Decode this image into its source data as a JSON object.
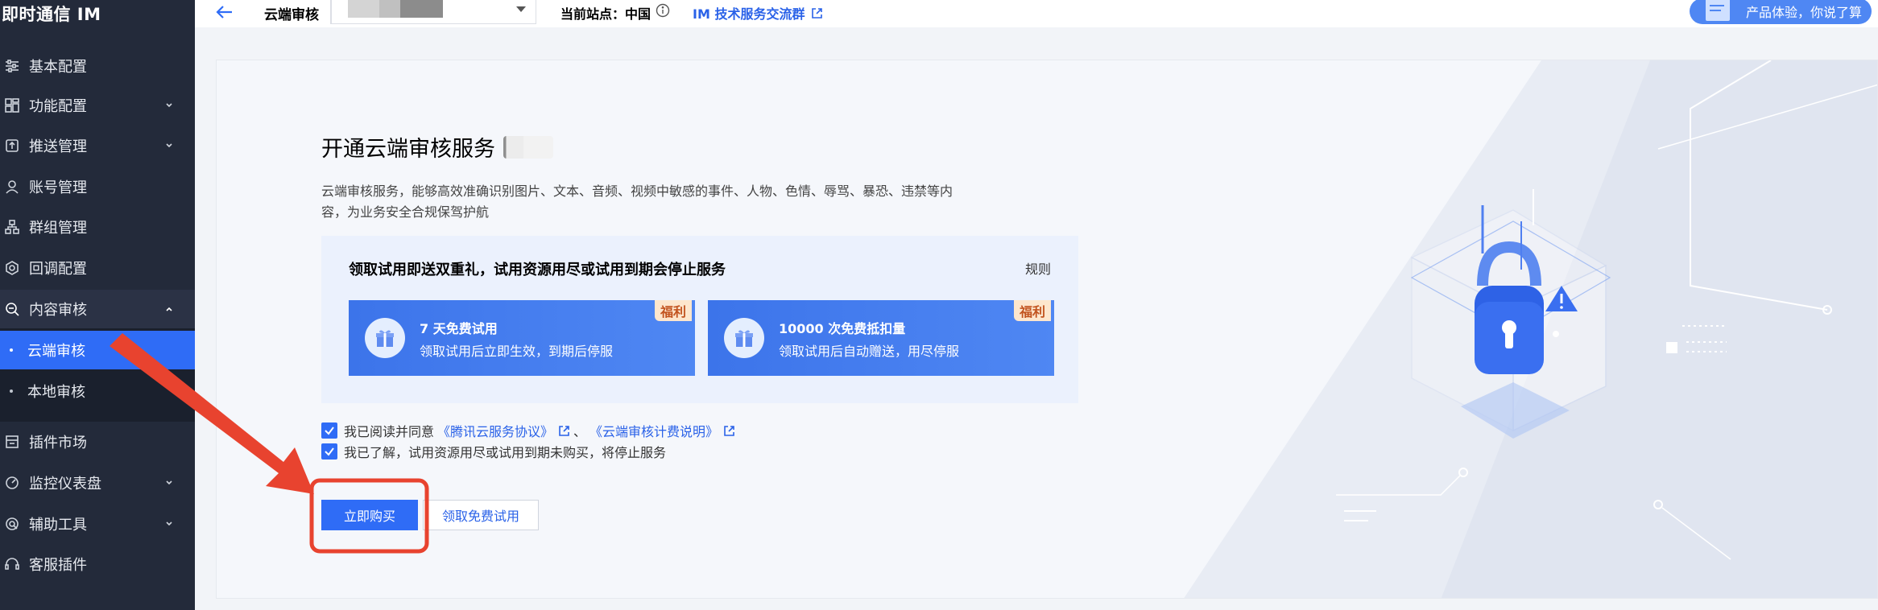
{
  "sidebar": {
    "brand": "即时通信 IM",
    "items": [
      {
        "label": "基本配置",
        "icon": "sliders-icon"
      },
      {
        "label": "功能配置",
        "icon": "grid-icon"
      },
      {
        "label": "推送管理",
        "icon": "push-icon"
      },
      {
        "label": "账号管理",
        "icon": "user-icon"
      },
      {
        "label": "群组管理",
        "icon": "group-icon"
      },
      {
        "label": "回调配置",
        "icon": "callback-icon"
      },
      {
        "label": "内容审核",
        "icon": "audit-icon"
      },
      {
        "label": "插件市场",
        "icon": "plugin-icon"
      },
      {
        "label": "监控仪表盘",
        "icon": "dashboard-icon"
      },
      {
        "label": "辅助工具",
        "icon": "tools-icon"
      },
      {
        "label": "客服插件",
        "icon": "headset-icon"
      }
    ],
    "subitems": [
      {
        "label": "云端审核"
      },
      {
        "label": "本地审核"
      }
    ]
  },
  "topbar": {
    "page_label": "云端审核",
    "site_label": "当前站点：",
    "site_value": "中国",
    "im_link": "IM 技术服务交流群",
    "feedback": "产品体验，你说了算"
  },
  "main": {
    "title": "开通云端审核服务",
    "description": "云端审核服务，能够高效准确识别图片、文本、音频、视频中敏感的事件、人物、色情、辱骂、暴恐、违禁等内容，为业务安全合规保驾护航",
    "trial": {
      "title": "领取试用即送双重礼，试用资源用尽或试用到期会停止服务",
      "rules": "规则",
      "benefits": [
        {
          "title": "7 天免费试用",
          "desc": "领取试用后立即生效，到期后停服",
          "tag": "福利"
        },
        {
          "title": "10000 次免费抵扣量",
          "desc": "领取试用后自动赠送，用尽停服",
          "tag": "福利"
        }
      ]
    },
    "agree1": {
      "prefix": "我已阅读并同意",
      "link1": "《腾讯云服务协议》",
      "sep": "、",
      "link2": "《云端审核计费说明》"
    },
    "agree2": "我已了解，试用资源用尽或试用到期未购买，将停止服务",
    "buy_button": "立即购买",
    "free_button": "领取免费试用"
  },
  "colors": {
    "sidebar_bg": "#232a3a",
    "accent": "#2f6cf6",
    "annotation": "#e8432f"
  }
}
